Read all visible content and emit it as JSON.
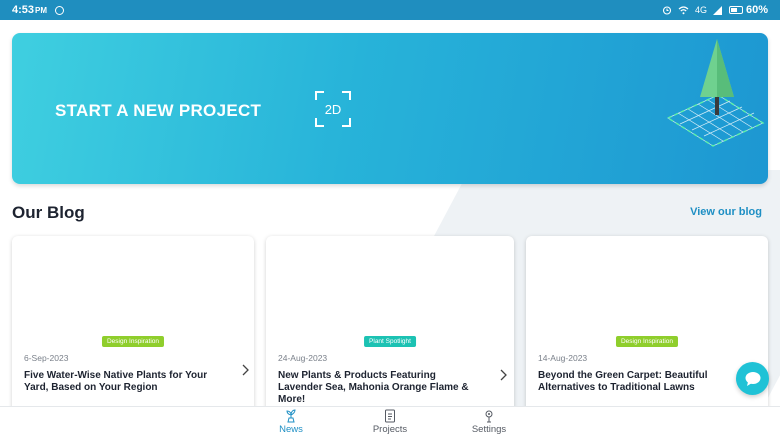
{
  "status_bar": {
    "time": "4:53",
    "ampm": "PM",
    "network": "4G",
    "battery": "60%"
  },
  "banner": {
    "title": "START A NEW PROJECT",
    "badge": "2D",
    "colors": {
      "start": "#3fcfe0",
      "end": "#1d97d2"
    }
  },
  "blog": {
    "heading": "Our Blog",
    "view_link": "View our blog",
    "posts": [
      {
        "tag": "Design Inspiration",
        "tag_color": "#8fce2c",
        "date": "6-Sep-2023",
        "title_lines": [
          "Five Water-Wise Native Plants for Your",
          "Yard, Based on Your Region"
        ]
      },
      {
        "tag": "Plant Spotlight",
        "tag_color": "#1cc2b3",
        "date": "24-Aug-2023",
        "title_lines": [
          "New Plants & Products Featuring",
          "Lavender Sea, Mahonia Orange Flame &",
          "More!"
        ]
      },
      {
        "tag": "Design Inspiration",
        "tag_color": "#8fce2c",
        "date": "14-Aug-2023",
        "title_lines": [
          "Beyond the Green Carpet: Beautiful",
          "Alternatives to Traditional Lawns"
        ]
      }
    ]
  },
  "nav": {
    "items": [
      {
        "label": "News",
        "icon": "plant-icon",
        "active": true
      },
      {
        "label": "Projects",
        "icon": "document-icon",
        "active": false
      },
      {
        "label": "Settings",
        "icon": "gear-plant-icon",
        "active": false
      }
    ],
    "active_color": "#1e8fc4",
    "inactive_color": "#555a63"
  }
}
